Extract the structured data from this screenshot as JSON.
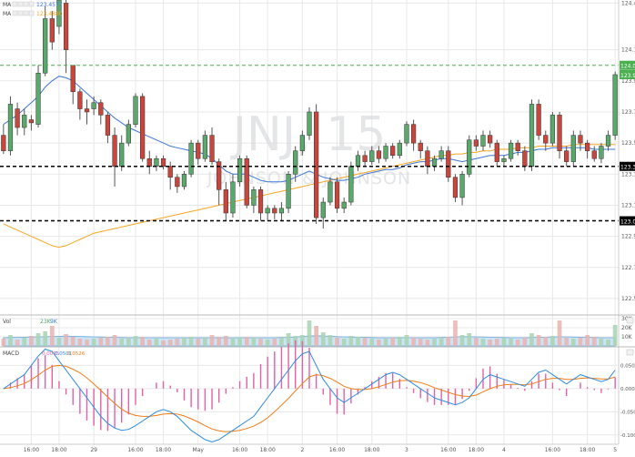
{
  "chart_data": {
    "type": "candlestick",
    "title": "",
    "watermark": {
      "symbol": "JNJ, 15",
      "name": "JOHNSON & JOHNSON"
    },
    "price_axis": {
      "ylim": [
        122.4,
        124.42
      ],
      "ticks": [
        {
          "v": 124.4,
          "label": "124.40"
        },
        {
          "v": 124.1,
          "label": "124.10"
        },
        {
          "v": 123.9,
          "label": "123.90"
        },
        {
          "v": 123.7,
          "label": "123.70"
        },
        {
          "v": 123.5,
          "label": "123.50"
        },
        {
          "v": 123.3,
          "label": "123.30"
        },
        {
          "v": 123.1,
          "label": "123.10"
        },
        {
          "v": 122.9,
          "label": "122.90"
        },
        {
          "v": 122.7,
          "label": "122.70"
        },
        {
          "v": 122.5,
          "label": "122.50"
        }
      ]
    },
    "levels": [
      {
        "v": 124.0,
        "label": "124.00",
        "style": "dashed",
        "color": "#4caf50",
        "tag_bg": "#4caf50"
      },
      {
        "v": 123.35,
        "label": "123.35",
        "style": "dashed",
        "color": "#000000",
        "tag_bg": "#000000"
      },
      {
        "v": 123.0,
        "label": "123.00",
        "style": "dashed",
        "color": "#000000",
        "tag_bg": "#000000"
      }
    ],
    "last_price": {
      "v": 123.94,
      "label": "123.94",
      "color": "#4caf50"
    },
    "legend": [
      {
        "name": "MA",
        "value": "123.4577",
        "color": "#3c78d8"
      },
      {
        "name": "MA",
        "value": "123.4880",
        "color": "#f6a623"
      }
    ],
    "x_ticks": [
      {
        "i": 4,
        "label": "16:00"
      },
      {
        "i": 8,
        "label": "18:00"
      },
      {
        "i": 13,
        "label": "29"
      },
      {
        "i": 19,
        "label": "16:00"
      },
      {
        "i": 23,
        "label": "18:00"
      },
      {
        "i": 28,
        "label": "May"
      },
      {
        "i": 34,
        "label": "16:00"
      },
      {
        "i": 38,
        "label": "18:00"
      },
      {
        "i": 43,
        "label": "2"
      },
      {
        "i": 48,
        "label": "16:00"
      },
      {
        "i": 53,
        "label": "18:00"
      },
      {
        "i": 58,
        "label": "3"
      },
      {
        "i": 64,
        "label": "16:00"
      },
      {
        "i": 68,
        "label": "18:00"
      },
      {
        "i": 72,
        "label": "4"
      },
      {
        "i": 79,
        "label": "16:00"
      },
      {
        "i": 84,
        "label": "18:00"
      },
      {
        "i": 88,
        "label": "5"
      }
    ],
    "candles": [
      [
        123.55,
        123.45,
        123.62,
        123.43
      ],
      [
        123.45,
        123.75,
        123.8,
        123.42
      ],
      [
        123.72,
        123.6,
        123.76,
        123.55
      ],
      [
        123.6,
        123.68,
        123.72,
        123.55
      ],
      [
        123.65,
        123.63,
        123.68,
        123.58
      ],
      [
        123.62,
        123.95,
        124.0,
        123.6
      ],
      [
        123.95,
        124.3,
        124.38,
        123.93
      ],
      [
        124.3,
        124.15,
        124.35,
        124.1
      ],
      [
        124.25,
        124.42,
        124.45,
        124.2
      ],
      [
        124.4,
        124.1,
        124.45,
        123.95
      ],
      [
        124.0,
        123.83,
        124.0,
        123.75
      ],
      [
        123.83,
        123.72,
        123.85,
        123.65
      ],
      [
        123.72,
        123.7,
        123.78,
        123.62
      ],
      [
        123.72,
        123.76,
        123.8,
        123.68
      ],
      [
        123.76,
        123.68,
        123.78,
        123.62
      ],
      [
        123.68,
        123.55,
        123.7,
        123.5
      ],
      [
        123.55,
        123.35,
        123.6,
        123.22
      ],
      [
        123.35,
        123.5,
        123.55,
        123.32
      ],
      [
        123.5,
        123.62,
        123.65,
        123.48
      ],
      [
        123.62,
        123.8,
        123.82,
        123.6
      ],
      [
        123.8,
        123.4,
        123.82,
        123.38
      ],
      [
        123.4,
        123.35,
        123.45,
        123.3
      ],
      [
        123.35,
        123.4,
        123.42,
        123.32
      ],
      [
        123.4,
        123.35,
        123.42,
        123.33
      ],
      [
        123.35,
        123.28,
        123.38,
        123.2
      ],
      [
        123.28,
        123.22,
        123.3,
        123.18
      ],
      [
        123.22,
        123.3,
        123.32,
        123.2
      ],
      [
        123.3,
        123.5,
        123.52,
        123.28
      ],
      [
        123.5,
        123.4,
        123.52,
        123.36
      ],
      [
        123.4,
        123.55,
        123.58,
        123.38
      ],
      [
        123.55,
        123.38,
        123.6,
        123.36
      ],
      [
        123.38,
        123.2,
        123.4,
        123.1
      ],
      [
        123.2,
        123.05,
        123.25,
        123.0
      ],
      [
        123.05,
        123.25,
        123.3,
        123.02
      ],
      [
        123.25,
        123.4,
        123.42,
        123.22
      ],
      [
        123.4,
        123.1,
        123.42,
        123.08
      ],
      [
        123.1,
        123.2,
        123.22,
        123.05
      ],
      [
        123.2,
        123.05,
        123.22,
        123.0
      ],
      [
        123.05,
        123.08,
        123.1,
        123.0
      ],
      [
        123.08,
        123.05,
        123.1,
        123.01
      ],
      [
        123.05,
        123.08,
        123.12,
        123.0
      ],
      [
        123.08,
        123.3,
        123.32,
        123.05
      ],
      [
        123.3,
        123.45,
        123.48,
        123.25
      ],
      [
        123.45,
        123.55,
        123.58,
        123.42
      ],
      [
        123.55,
        123.7,
        123.73,
        123.52
      ],
      [
        123.7,
        123.02,
        123.75,
        122.98
      ],
      [
        123.02,
        123.12,
        123.15,
        122.95
      ],
      [
        123.12,
        123.25,
        123.28,
        123.1
      ],
      [
        123.25,
        123.08,
        123.28,
        123.05
      ],
      [
        123.08,
        123.12,
        123.15,
        123.05
      ],
      [
        123.12,
        123.35,
        123.38,
        123.1
      ],
      [
        123.35,
        123.42,
        123.45,
        123.32
      ],
      [
        123.42,
        123.38,
        123.45,
        123.35
      ],
      [
        123.38,
        123.45,
        123.48,
        123.36
      ],
      [
        123.45,
        123.4,
        123.48,
        123.37
      ],
      [
        123.4,
        123.48,
        123.5,
        123.38
      ],
      [
        123.48,
        123.42,
        123.5,
        123.4
      ],
      [
        123.42,
        123.5,
        123.52,
        123.4
      ],
      [
        123.5,
        123.62,
        123.64,
        123.48
      ],
      [
        123.62,
        123.5,
        123.65,
        123.45
      ],
      [
        123.5,
        123.45,
        123.52,
        123.4
      ],
      [
        123.45,
        123.35,
        123.48,
        123.3
      ],
      [
        123.35,
        123.4,
        123.42,
        123.32
      ],
      [
        123.4,
        123.45,
        123.48,
        123.38
      ],
      [
        123.45,
        123.28,
        123.48,
        123.25
      ],
      [
        123.28,
        123.15,
        123.3,
        123.12
      ],
      [
        123.15,
        123.3,
        123.32,
        123.1
      ],
      [
        123.3,
        123.52,
        123.55,
        123.28
      ],
      [
        123.52,
        123.48,
        123.55,
        123.45
      ],
      [
        123.48,
        123.55,
        123.58,
        123.45
      ],
      [
        123.55,
        123.5,
        123.58,
        123.47
      ],
      [
        123.5,
        123.38,
        123.52,
        123.35
      ],
      [
        123.38,
        123.4,
        123.42,
        123.35
      ],
      [
        123.4,
        123.5,
        123.52,
        123.38
      ],
      [
        123.5,
        123.45,
        123.52,
        123.42
      ],
      [
        123.45,
        123.35,
        123.48,
        123.32
      ],
      [
        123.35,
        123.75,
        123.78,
        123.32
      ],
      [
        123.75,
        123.55,
        123.78,
        123.52
      ],
      [
        123.55,
        123.5,
        123.58,
        123.45
      ],
      [
        123.5,
        123.68,
        123.7,
        123.48
      ],
      [
        123.68,
        123.45,
        123.7,
        123.4
      ],
      [
        123.45,
        123.38,
        123.48,
        123.35
      ],
      [
        123.38,
        123.55,
        123.58,
        123.35
      ],
      [
        123.55,
        123.5,
        123.58,
        123.45
      ],
      [
        123.5,
        123.45,
        123.52,
        123.4
      ],
      [
        123.45,
        123.4,
        123.48,
        123.38
      ],
      [
        123.4,
        123.48,
        123.5,
        123.37
      ],
      [
        123.48,
        123.55,
        123.58,
        123.45
      ],
      [
        123.55,
        123.94,
        123.96,
        123.52
      ]
    ],
    "ma_fast": [
      123.62,
      123.65,
      123.68,
      123.72,
      123.76,
      123.8,
      123.86,
      123.9,
      123.93,
      123.92,
      123.9,
      123.86,
      123.82,
      123.78,
      123.74,
      123.7,
      123.66,
      123.63,
      123.6,
      123.58,
      123.56,
      123.54,
      123.52,
      123.5,
      123.48,
      123.47,
      123.46,
      123.45,
      123.44,
      123.43,
      123.4,
      123.36,
      123.32,
      123.3,
      123.3,
      123.3,
      123.28,
      123.26,
      123.25,
      123.25,
      123.25,
      123.26,
      123.28,
      123.3,
      123.32,
      123.3,
      123.28,
      123.27,
      123.26,
      123.26,
      123.27,
      123.28,
      123.3,
      123.31,
      123.32,
      123.33,
      123.33,
      123.34,
      123.36,
      123.37,
      123.38,
      123.38,
      123.39,
      123.4,
      123.4,
      123.39,
      123.38,
      123.39,
      123.4,
      123.41,
      123.42,
      123.42,
      123.42,
      123.43,
      123.44,
      123.44,
      123.45,
      123.46,
      123.46,
      123.47,
      123.47,
      123.47,
      123.47,
      123.47,
      123.47,
      123.46,
      123.46,
      123.46,
      123.46
    ],
    "ma_slow": [
      122.98,
      122.96,
      122.94,
      122.92,
      122.9,
      122.88,
      122.86,
      122.84,
      122.83,
      122.84,
      122.86,
      122.88,
      122.9,
      122.92,
      122.93,
      122.94,
      122.95,
      122.96,
      122.97,
      122.98,
      122.99,
      123.0,
      123.01,
      123.02,
      123.03,
      123.04,
      123.05,
      123.06,
      123.07,
      123.08,
      123.09,
      123.1,
      123.11,
      123.12,
      123.13,
      123.14,
      123.15,
      123.16,
      123.17,
      123.18,
      123.19,
      123.2,
      123.21,
      123.22,
      123.23,
      123.24,
      123.25,
      123.26,
      123.27,
      123.28,
      123.29,
      123.3,
      123.31,
      123.32,
      123.33,
      123.34,
      123.35,
      123.36,
      123.37,
      123.38,
      123.39,
      123.4,
      123.41,
      123.42,
      123.42,
      123.43,
      123.43,
      123.44,
      123.44,
      123.45,
      123.45,
      123.46,
      123.46,
      123.46,
      123.47,
      123.47,
      123.47,
      123.48,
      123.48,
      123.48,
      123.48,
      123.48,
      123.49,
      123.49,
      123.49,
      123.49,
      123.49,
      123.49,
      123.49
    ],
    "volume": {
      "label": "Vol",
      "value": "23K",
      "value2": "9K",
      "ylim": [
        0,
        30000
      ],
      "ticks": [
        {
          "v": 30000,
          "label": "30K"
        },
        {
          "v": 20000,
          "label": "20K"
        },
        {
          "v": 10000,
          "label": "10K"
        }
      ],
      "values": [
        8000,
        12000,
        7000,
        9000,
        11000,
        14000,
        16000,
        22000,
        9000,
        13000,
        10000,
        8000,
        7000,
        8000,
        9000,
        10000,
        12000,
        8000,
        9000,
        11000,
        10000,
        7000,
        8000,
        6000,
        7000,
        8000,
        9000,
        10000,
        8000,
        9000,
        12000,
        10000,
        11000,
        8000,
        9000,
        10000,
        9000,
        8000,
        7000,
        8000,
        9000,
        14000,
        11000,
        12000,
        28000,
        22000,
        15000,
        12000,
        9000,
        8000,
        11000,
        10000,
        9000,
        8000,
        7000,
        8000,
        9000,
        10000,
        12000,
        9000,
        8000,
        7000,
        8000,
        9000,
        10000,
        28000,
        12000,
        14000,
        9000,
        8000,
        7000,
        8000,
        9000,
        8000,
        7000,
        9000,
        14000,
        12000,
        10000,
        11000,
        28000,
        9000,
        8000,
        9000,
        12000,
        10000,
        8000,
        7000,
        23000
      ],
      "vol_ma": [
        9000,
        9200,
        9400,
        9600,
        9800,
        10000,
        10200,
        10400,
        10600,
        10800,
        10600,
        10400,
        10200,
        10000,
        9800,
        9600,
        9400,
        9200,
        9000,
        9000,
        9000,
        9000,
        9000,
        9000,
        9000,
        9000,
        9000,
        9000,
        9000,
        9000,
        9000,
        9000,
        9000,
        9000,
        9000,
        9000,
        9000,
        9000,
        9000,
        9000,
        9200,
        9400,
        9800,
        10400,
        11000,
        11200,
        11000,
        10600,
        10200,
        10000,
        9800,
        9600,
        9400,
        9200,
        9000,
        9000,
        9000,
        9000,
        9000,
        9000,
        9000,
        9000,
        9000,
        9200,
        9600,
        10000,
        10200,
        10200,
        10000,
        9800,
        9600,
        9400,
        9200,
        9000,
        9000,
        9000,
        9200,
        9400,
        9600,
        9800,
        10000,
        10000,
        9800,
        9600,
        9400,
        9200,
        9000,
        9000,
        9000
      ]
    },
    "macd": {
      "label": "MACD",
      "values_text": [
        "0.0075",
        "0.0501",
        "0.0526"
      ],
      "ylim": [
        -0.12,
        0.09
      ],
      "ticks": [
        {
          "v": 0.05,
          "label": "0.0500"
        },
        {
          "v": 0.0,
          "label": "0.0000"
        },
        {
          "v": -0.05,
          "label": "-0.0500"
        },
        {
          "v": -0.1,
          "label": "-0.1000"
        }
      ],
      "macd_line": [
        0.0,
        0.01,
        0.02,
        0.03,
        0.05,
        0.07,
        0.085,
        0.08,
        0.06,
        0.04,
        0.02,
        0.0,
        -0.02,
        -0.04,
        -0.06,
        -0.075,
        -0.085,
        -0.09,
        -0.088,
        -0.08,
        -0.07,
        -0.06,
        -0.05,
        -0.045,
        -0.05,
        -0.06,
        -0.075,
        -0.09,
        -0.1,
        -0.11,
        -0.115,
        -0.11,
        -0.1,
        -0.09,
        -0.08,
        -0.07,
        -0.06,
        -0.04,
        -0.02,
        0.0,
        0.02,
        0.04,
        0.06,
        0.075,
        0.08,
        0.05,
        0.02,
        0.0,
        -0.02,
        -0.03,
        -0.02,
        -0.01,
        0.0,
        0.01,
        0.02,
        0.03,
        0.035,
        0.03,
        0.02,
        0.01,
        0.0,
        -0.01,
        -0.02,
        -0.025,
        -0.03,
        -0.035,
        -0.03,
        -0.02,
        0.0,
        0.02,
        0.03,
        0.025,
        0.02,
        0.015,
        0.01,
        0.005,
        0.02,
        0.035,
        0.04,
        0.03,
        0.02,
        0.01,
        0.02,
        0.03,
        0.025,
        0.02,
        0.015,
        0.02,
        0.04
      ],
      "signal_line": [
        0.0,
        0.002,
        0.006,
        0.011,
        0.019,
        0.029,
        0.04,
        0.048,
        0.05,
        0.048,
        0.042,
        0.034,
        0.023,
        0.01,
        -0.004,
        -0.018,
        -0.032,
        -0.044,
        -0.053,
        -0.058,
        -0.06,
        -0.06,
        -0.058,
        -0.055,
        -0.054,
        -0.055,
        -0.059,
        -0.065,
        -0.072,
        -0.08,
        -0.087,
        -0.091,
        -0.093,
        -0.092,
        -0.09,
        -0.086,
        -0.081,
        -0.073,
        -0.063,
        -0.05,
        -0.036,
        -0.021,
        -0.005,
        0.011,
        0.025,
        0.03,
        0.028,
        0.022,
        0.014,
        0.005,
        0.0,
        -0.002,
        -0.002,
        0.0,
        0.004,
        0.009,
        0.014,
        0.017,
        0.018,
        0.016,
        0.013,
        0.008,
        0.002,
        -0.003,
        -0.008,
        -0.013,
        -0.016,
        -0.017,
        -0.014,
        -0.007,
        0.0,
        0.005,
        0.008,
        0.009,
        0.009,
        0.008,
        0.01,
        0.015,
        0.02,
        0.022,
        0.022,
        0.02,
        0.02,
        0.022,
        0.023,
        0.022,
        0.021,
        0.021,
        0.025
      ]
    },
    "colors": {
      "up": "#5aa86b",
      "down": "#c9463d",
      "ma_fast": "#3c78d8",
      "ma_slow": "#f6a623",
      "grid": "#e8e8e8",
      "macd": "#2f8be0",
      "signal": "#f07d1a",
      "hist_pos": "#e55fa8",
      "hist_neg": "#e55fa8",
      "vol_up": "#a9d4b1",
      "vol_down": "#e9b3b0",
      "vol_ma": "#8ec5ea"
    }
  }
}
